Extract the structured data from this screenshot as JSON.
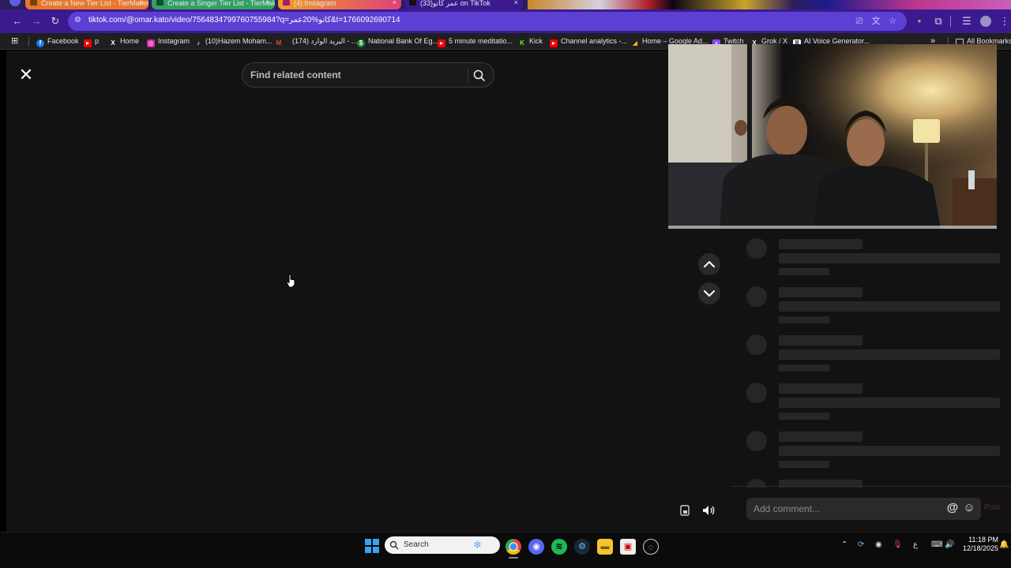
{
  "browser": {
    "tabs": [
      {
        "label": "Create a New Tier List - TierMaker",
        "color": "#e86a1d"
      },
      {
        "label": "Create a Singer Tier List - TierMaker",
        "color": "#2e9b57"
      },
      {
        "label": "(4) Instagram",
        "color": "#d64a8a"
      },
      {
        "label": "(33)عمر كاتو on TikTok",
        "color": "#2a2a2a"
      }
    ],
    "url": "tiktok.com/@omar.kato/video/7564834799760755984?q=كاتو%20عمر&t=1766092690714",
    "bookmarks": [
      {
        "label": "Facebook",
        "icon": "facebook-icon",
        "color": "#1877f2"
      },
      {
        "label": "p",
        "icon": "youtube-icon",
        "color": "#ff0000"
      },
      {
        "label": "Home",
        "icon": "x-icon",
        "color": "#ffffff"
      },
      {
        "label": "Instagram",
        "icon": "instagram-icon",
        "color": "#d6249f"
      },
      {
        "label": "(10)Hazem Moham...",
        "icon": "tiktok-icon",
        "color": "#ffffff"
      },
      {
        "label": "",
        "icon": "gmail-icon",
        "color": "#ea4335"
      },
      {
        "label": "(174) البريد الوارد - ...",
        "icon": "mail-icon",
        "color": "#ffffff"
      },
      {
        "label": "National Bank Of Eg...",
        "icon": "bank-icon",
        "color": "#1b8a3a"
      },
      {
        "label": "5 minute meditatio...",
        "icon": "youtube-icon",
        "color": "#ff0000"
      },
      {
        "label": "Kick",
        "icon": "kick-icon",
        "color": "#53fc18"
      },
      {
        "label": "Channel analytics -...",
        "icon": "youtube-studio-icon",
        "color": "#ff0000"
      },
      {
        "label": "Home – Google Ad...",
        "icon": "google-ads-icon",
        "color": "#fbbc04"
      },
      {
        "label": "Twitch",
        "icon": "twitch-icon",
        "color": "#9146ff"
      },
      {
        "label": "Grok / X",
        "icon": "x-icon",
        "color": "#ffffff"
      },
      {
        "label": "AI Voice Generator...",
        "icon": "elevenlabs-icon",
        "color": "#ffffff"
      }
    ],
    "all_bookmarks_label": "All Bookmarks"
  },
  "main": {
    "search_placeholder": "Find related content"
  },
  "comments": {
    "placeholder": "Add comment...",
    "at_symbol": "@",
    "emoji_symbol": "☺",
    "post_label": "Post"
  },
  "taskbar": {
    "search_label": "Search",
    "time": "11:18 PM",
    "date": "12/18/2025",
    "lang": "ع"
  }
}
